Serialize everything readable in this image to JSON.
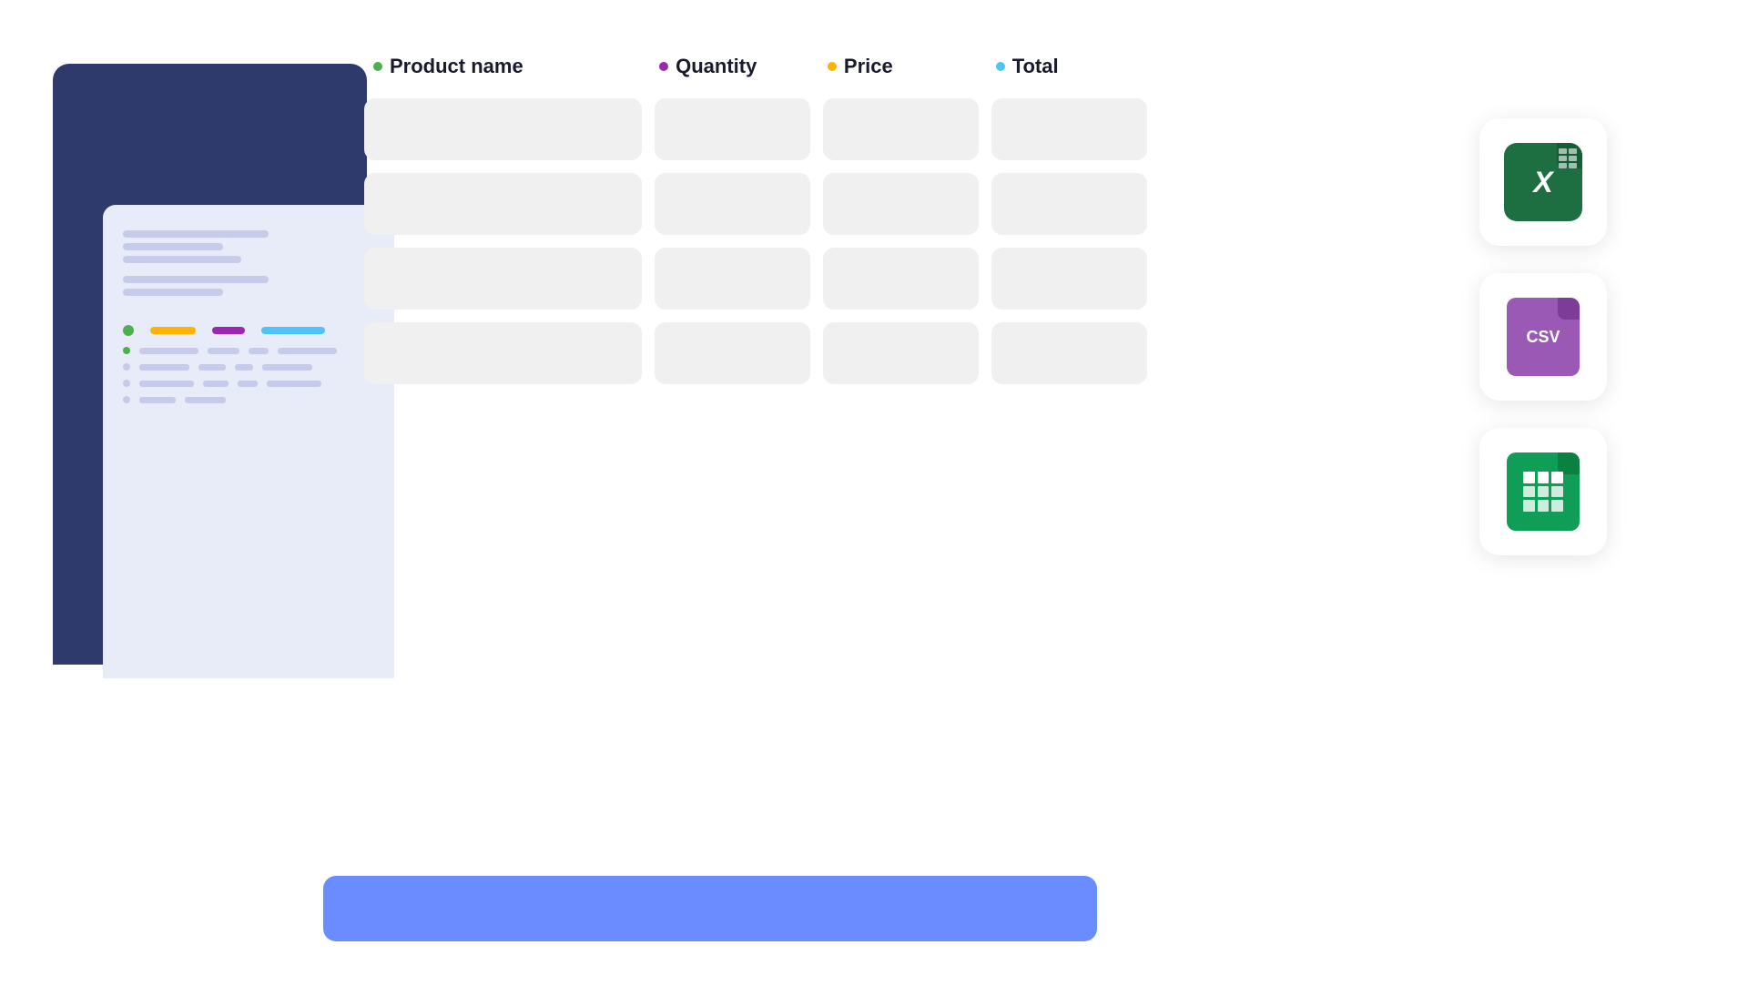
{
  "background": "#ffffff",
  "illustration": {
    "dark_panel_color": "#2d3a6b",
    "doc_panel_color": "#e8ecf8",
    "doc_lines": [
      {
        "widths": [
          "long",
          "medium",
          "short"
        ]
      },
      {
        "widths": [
          "long",
          "medium"
        ]
      }
    ],
    "color_indicators": [
      {
        "color": "#4caf50"
      },
      {
        "color": "#ffb300"
      },
      {
        "color": "#9c27b0"
      },
      {
        "color": "#4fc3f7"
      }
    ]
  },
  "table": {
    "columns": [
      {
        "label": "Product name",
        "dot_color": "#4caf50"
      },
      {
        "label": "Quantity",
        "dot_color": "#9c27b0"
      },
      {
        "label": "Price",
        "dot_color": "#ffb300"
      },
      {
        "label": "Total",
        "dot_color": "#4fc3f7"
      }
    ],
    "rows": 4,
    "empty_cell_color": "#f0f0f0"
  },
  "icons": [
    {
      "name": "excel",
      "label": "Excel"
    },
    {
      "name": "csv",
      "label": "CSV"
    },
    {
      "name": "sheets",
      "label": "Google Sheets"
    }
  ],
  "bottom_bar_color": "#6b8cff"
}
